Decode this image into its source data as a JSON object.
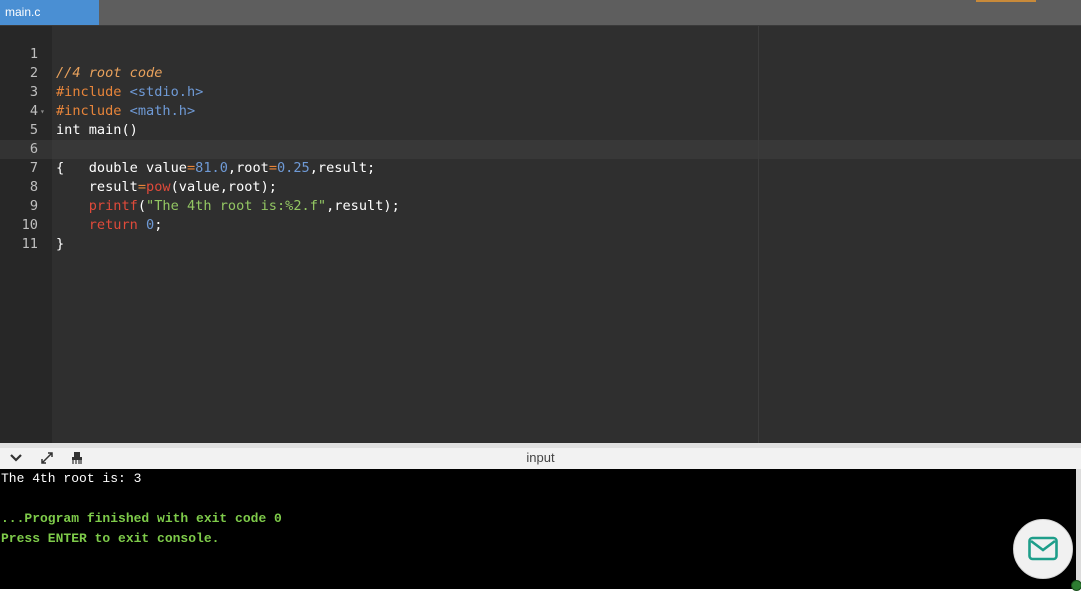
{
  "tab": {
    "file_name": "main.c"
  },
  "editor": {
    "lines": [
      {
        "num": "1"
      },
      {
        "num": "2"
      },
      {
        "num": "3"
      },
      {
        "num": "4"
      },
      {
        "num": "5",
        "fold": "▾"
      },
      {
        "num": "6"
      },
      {
        "num": "7"
      },
      {
        "num": "8"
      },
      {
        "num": "9"
      },
      {
        "num": "10"
      },
      {
        "num": "11"
      }
    ],
    "code": {
      "l1_comment": "//4 root code",
      "l2_directive": "#include",
      "l2_header": "<stdio.h>",
      "l3_directive": "#include",
      "l3_header": "<math.h>",
      "l4_text": "int main()",
      "l5_text": "{",
      "l6_prefix": "    double value",
      "l6_eq1": "=",
      "l6_num1": "81.0",
      "l6_mid": ",root",
      "l6_eq2": "=",
      "l6_num2": "0.25",
      "l6_suffix": ",result;",
      "l7_prefix": "    result",
      "l7_eq": "=",
      "l7_fn": "pow",
      "l7_suffix": "(value,root);",
      "l8_indent": "    ",
      "l8_fn": "printf",
      "l8_open": "(",
      "l8_str": "\"The 4th root is:%2.f\"",
      "l8_suffix": ",result);",
      "l9_indent": "    ",
      "l9_kw": "return",
      "l9_space": " ",
      "l9_num": "0",
      "l9_semi": ";",
      "l10_text": "}",
      "l11_text": ""
    }
  },
  "console": {
    "header_label": "input",
    "output_line": "The 4th root is: 3",
    "finish_line": "...Program finished with exit code 0",
    "exit_line": "Press ENTER to exit console."
  },
  "icons": {
    "collapse": "chevron-down-icon",
    "expand": "expand-icon",
    "clear": "clear-console-icon",
    "mail": "mail-icon"
  },
  "colors": {
    "tab_active": "#4a8fd3",
    "editor_bg": "#2f2f2f",
    "console_bg": "#000000",
    "console_green": "#7ecb4a"
  }
}
